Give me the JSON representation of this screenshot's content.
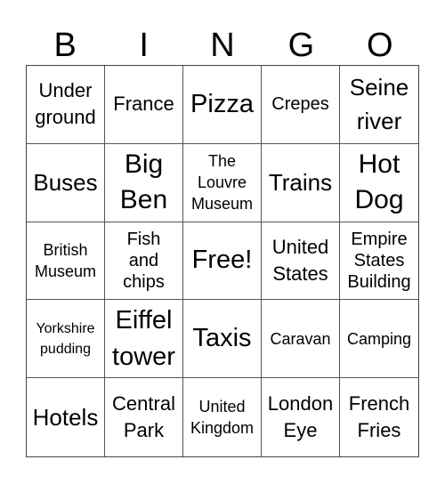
{
  "header": {
    "letters": [
      "B",
      "I",
      "N",
      "G",
      "O"
    ]
  },
  "cells": [
    "Under\nground",
    "France",
    "Pizza",
    "Crepes",
    "Seine\nriver",
    "Buses",
    "Big\nBen",
    "The\nLouvre\nMuseum",
    "Trains",
    "Hot\nDog",
    "British\nMuseum",
    "Fish\nand\nchips",
    "Free!",
    "United\nStates",
    "Empire\nStates\nBuilding",
    "Yorkshire\npudding",
    "Eiffel\ntower",
    "Taxis",
    "Caravan",
    "Camping",
    "Hotels",
    "Central\nPark",
    "United\nKingdom",
    "London\nEye",
    "French\nFries"
  ]
}
